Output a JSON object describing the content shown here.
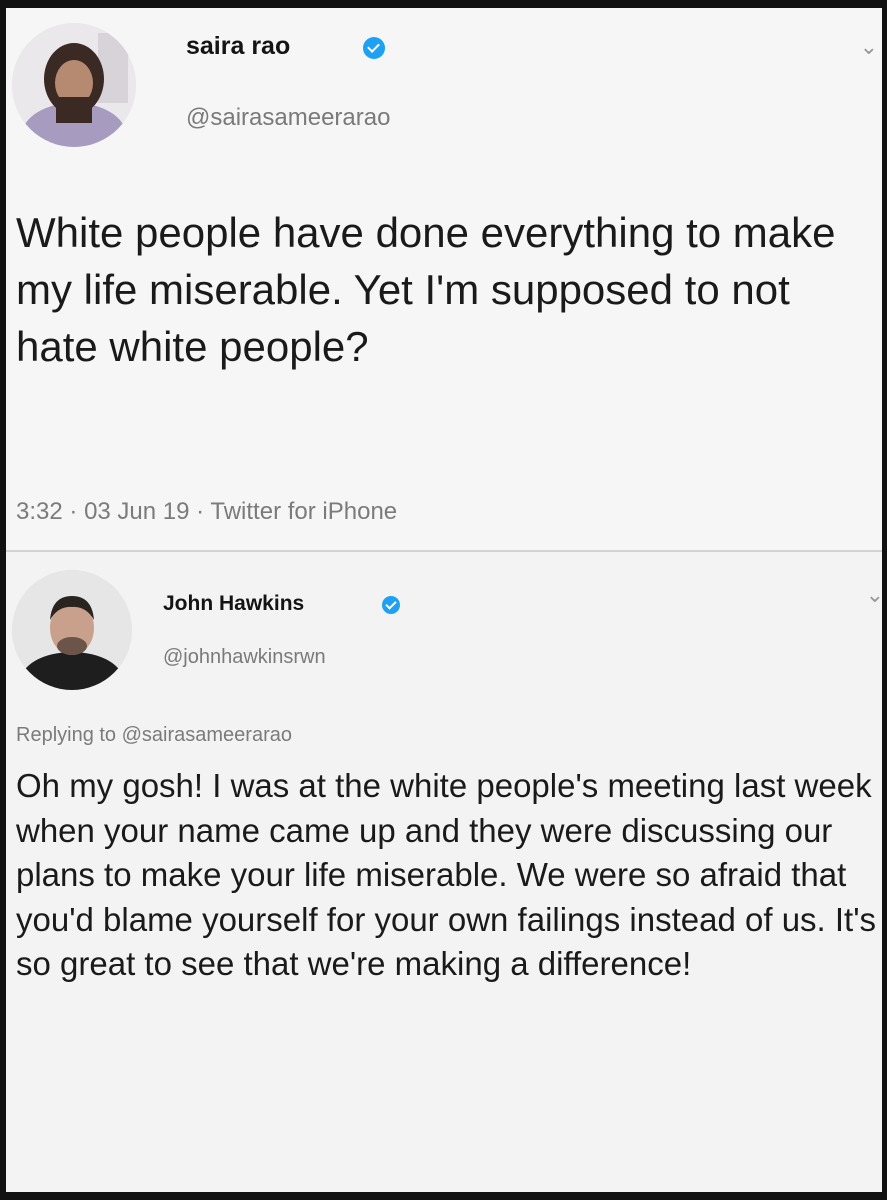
{
  "tweet": {
    "author_name": "saira rao",
    "author_handle": "@sairasameerarao",
    "text": "White people have done everything to make my life miserable. Yet I'm supposed to not hate white people?",
    "time": "3:32",
    "date": "03 Jun 19",
    "source": "Twitter for iPhone"
  },
  "reply": {
    "author_name": "John Hawkins",
    "author_handle": "@johnhawkinsrwn",
    "replying_label": "Replying to",
    "replying_handle": "@sairasameerarao",
    "text": "Oh my gosh! I was at the white people's meeting last week when your name came up and they were discussing our plans to make your life miserable. We were so afraid that you'd blame yourself for your own failings instead of us. It's so great to see that we're making a difference!"
  },
  "icons": {
    "verified": "verified-badge-icon",
    "menu": "chevron-down-icon"
  },
  "colors": {
    "verified": "#1da1f2",
    "text": "#1a1a1a",
    "muted": "#7b7b7b"
  }
}
